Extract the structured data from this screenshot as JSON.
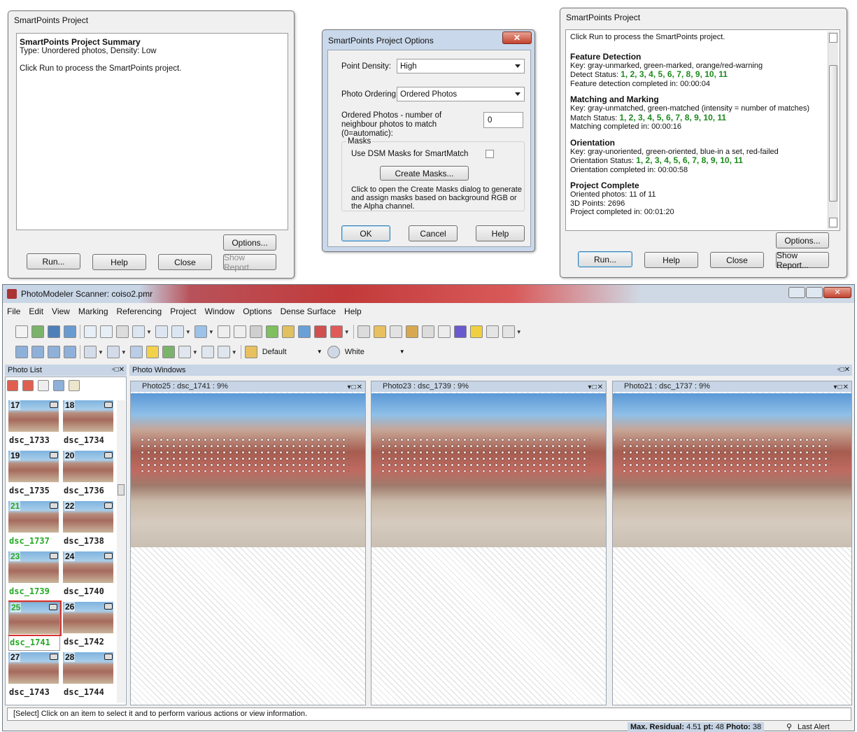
{
  "dlg1": {
    "title": "SmartPoints Project",
    "summary_title": "SmartPoints Project Summary",
    "summary_type": "Type: Unordered photos, Density: Low",
    "summary_msg": "Click Run to process the SmartPoints project.",
    "options": "Options...",
    "run": "Run...",
    "help": "Help",
    "close": "Close",
    "show_report": "Show Report..."
  },
  "dlg2": {
    "title": "SmartPoints Project Options",
    "close_x": "✕",
    "density_label": "Point Density:",
    "density_value": "High",
    "ordering_label": "Photo Ordering:",
    "ordering_value": "Ordered Photos",
    "neighbour_label": "Ordered Photos - number of neighbour photos to match (0=automatic):",
    "neighbour_value": "0",
    "masks_group": "Masks",
    "use_dsm": "Use DSM Masks for SmartMatch",
    "create_masks": "Create Masks...",
    "masks_desc": "Click to open the Create Masks dialog to generate and assign masks based on background RGB or the Alpha channel.",
    "ok": "OK",
    "cancel": "Cancel",
    "help": "Help"
  },
  "dlg3": {
    "title": "SmartPoints Project",
    "intro": "Click Run to process the SmartPoints project.",
    "fd_title": "Feature Detection",
    "fd_key": "Key: gray-unmarked, green-marked, orange/red-warning",
    "fd_status_label": "Detect Status:",
    "fd_status": "1, 2, 3, 4, 5, 6, 7, 8, 9, 10, 11",
    "fd_done": "Feature detection completed in: 00:00:04",
    "mm_title": "Matching and Marking",
    "mm_key": "Key: gray-unmatched, green-matched (intensity = number of matches)",
    "mm_status_label": "Match Status:",
    "mm_status": "1, 2, 3, 4, 5, 6, 7, 8, 9, 10, 11",
    "mm_done": "Matching completed in: 00:00:16",
    "or_title": "Orientation",
    "or_key": "Key: gray-unoriented, green-oriented, blue-in a set, red-failed",
    "or_status_label": "Orientation Status:",
    "or_status": "1, 2, 3, 4, 5, 6, 7, 8, 9, 10, 11",
    "or_done": "Orientation completed in: 00:00:58",
    "pc_title": "Project Complete",
    "pc_oriented": "Oriented photos: 11 of 11",
    "pc_points": "3D Points: 2696",
    "pc_done": "Project completed in: 00:01:20",
    "options": "Options...",
    "run": "Run...",
    "help": "Help",
    "close": "Close",
    "show_report": "Show Report..."
  },
  "main": {
    "title": "PhotoModeler Scanner: coiso2.pmr",
    "menu": [
      "File",
      "Edit",
      "View",
      "Marking",
      "Referencing",
      "Project",
      "Window",
      "Options",
      "Dense Surface",
      "Help"
    ],
    "toolbar_default": "Default",
    "toolbar_white": "White",
    "photo_list_title": "Photo List",
    "photo_windows_title": "Photo Windows",
    "thumbs": [
      {
        "num": "17",
        "cap": "dsc_1733"
      },
      {
        "num": "18",
        "cap": "dsc_1734"
      },
      {
        "num": "19",
        "cap": "dsc_1735"
      },
      {
        "num": "20",
        "cap": "dsc_1736"
      },
      {
        "num": "21",
        "cap": "dsc_1737"
      },
      {
        "num": "22",
        "cap": "dsc_1738"
      },
      {
        "num": "23",
        "cap": "dsc_1739"
      },
      {
        "num": "24",
        "cap": "dsc_1740"
      },
      {
        "num": "25",
        "cap": "dsc_1741"
      },
      {
        "num": "26",
        "cap": "dsc_1742"
      },
      {
        "num": "27",
        "cap": "dsc_1743"
      },
      {
        "num": "28",
        "cap": "dsc_1744"
      }
    ],
    "photo_windows": [
      {
        "title": "Photo25 : dsc_1741 : 9%"
      },
      {
        "title": "Photo23 : dsc_1739 : 9%"
      },
      {
        "title": "Photo21 : dsc_1737 : 9%"
      }
    ],
    "status_msg": "[Select] Click on an item to select it and to perform various actions or view information.",
    "max_residual_label": "Max. Residual:",
    "max_residual_value": "4.51",
    "pt_label": "pt:",
    "pt_value": "48",
    "photo_label": "Photo:",
    "photo_value": "38",
    "last_alert": "Last Alert"
  }
}
